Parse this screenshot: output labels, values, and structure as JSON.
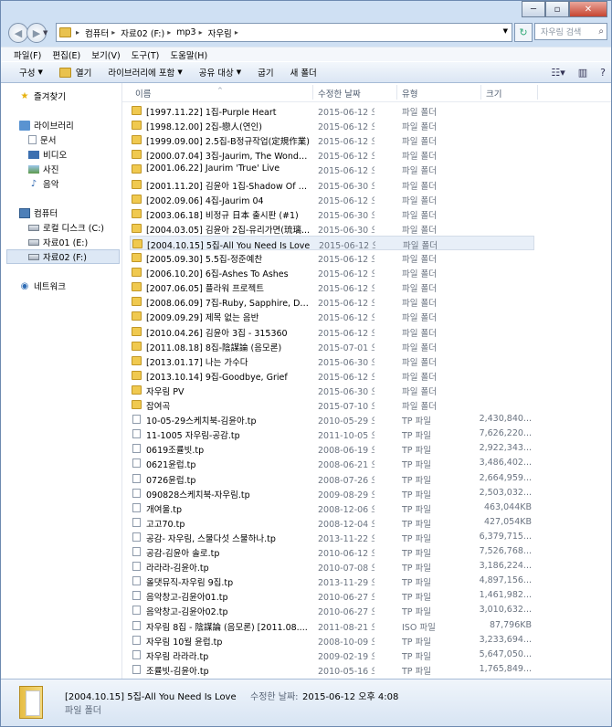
{
  "window": {
    "address": [
      "컴퓨터",
      "자료02 (F:)",
      "mp3",
      "자우림"
    ],
    "search_placeholder": "자우림 검색"
  },
  "menu": [
    "파일(F)",
    "편집(E)",
    "보기(V)",
    "도구(T)",
    "도움말(H)"
  ],
  "toolbar": {
    "organize": "구성",
    "open": "열기",
    "include_library": "라이브러리에 포함",
    "share": "공유 대상",
    "burn": "굽기",
    "new_folder": "새 폴더"
  },
  "nav": {
    "favorites": "즐겨찾기",
    "libraries": "라이브러리",
    "documents": "문서",
    "videos": "비디오",
    "pictures": "사진",
    "music": "음악",
    "computer": "컴퓨터",
    "local_disk": "로컬 디스크 (C:)",
    "data01": "자료01 (E:)",
    "data02": "자료02 (F:)",
    "network": "네트워크"
  },
  "columns": {
    "name": "이름",
    "date": "수정한 날짜",
    "type": "유형",
    "size": "크기"
  },
  "rows": [
    {
      "name": "[1997.11.22] 1집-Purple Heart",
      "date": "2015-06-12 오후...",
      "type": "파일 폴더",
      "size": "",
      "kind": "folder"
    },
    {
      "name": "[1998.12.00] 2집-戀人(연인)",
      "date": "2015-06-12 오후...",
      "type": "파일 폴더",
      "size": "",
      "kind": "folder"
    },
    {
      "name": "[1999.09.00] 2.5집-B정규작업(定規作業)",
      "date": "2015-06-12 오후...",
      "type": "파일 폴더",
      "size": "",
      "kind": "folder"
    },
    {
      "name": "[2000.07.04] 3집-Jaurim, The Wonder L...",
      "date": "2015-06-12 오후...",
      "type": "파일 폴더",
      "size": "",
      "kind": "folder"
    },
    {
      "name": "[2001.06.22] Jaurim 'True' Live",
      "date": "2015-06-12 오후...",
      "type": "파일 폴더",
      "size": "",
      "kind": "folder"
    },
    {
      "name": "[2001.11.20] 김윤아 1집-Shadow Of Yo...",
      "date": "2015-06-30 오후...",
      "type": "파일 폴더",
      "size": "",
      "kind": "folder"
    },
    {
      "name": "[2002.09.06] 4집-Jaurim 04",
      "date": "2015-06-12 오후...",
      "type": "파일 폴더",
      "size": "",
      "kind": "folder"
    },
    {
      "name": "[2003.06.18] 비정규 日本 출시판 (#1)",
      "date": "2015-06-30 오후...",
      "type": "파일 폴더",
      "size": "",
      "kind": "folder"
    },
    {
      "name": "[2004.03.05] 김윤아 2집-유리가면(琉璃...",
      "date": "2015-06-30 오후...",
      "type": "파일 폴더",
      "size": "",
      "kind": "folder"
    },
    {
      "name": "[2004.10.15] 5집-All You Need Is Love",
      "date": "2015-06-12 오후...",
      "type": "파일 폴더",
      "size": "",
      "kind": "folder",
      "selected": true
    },
    {
      "name": "[2005.09.30] 5.5집-정준예찬",
      "date": "2015-06-12 오후...",
      "type": "파일 폴더",
      "size": "",
      "kind": "folder"
    },
    {
      "name": "[2006.10.20] 6집-Ashes To Ashes",
      "date": "2015-06-12 오후...",
      "type": "파일 폴더",
      "size": "",
      "kind": "folder"
    },
    {
      "name": "[2007.06.05] 플라워 프로젝트",
      "date": "2015-06-12 오후...",
      "type": "파일 폴더",
      "size": "",
      "kind": "folder"
    },
    {
      "name": "[2008.06.09] 7집-Ruby, Sapphire, Diam...",
      "date": "2015-06-12 오후...",
      "type": "파일 폴더",
      "size": "",
      "kind": "folder"
    },
    {
      "name": "[2009.09.29] 제목 없는 음반",
      "date": "2015-06-12 오후...",
      "type": "파일 폴더",
      "size": "",
      "kind": "folder"
    },
    {
      "name": "[2010.04.26] 김윤아 3집 - 315360",
      "date": "2015-06-12 오후...",
      "type": "파일 폴더",
      "size": "",
      "kind": "folder"
    },
    {
      "name": "[2011.08.18] 8집-陰謀論 (음모론)",
      "date": "2015-07-01 오전...",
      "type": "파일 폴더",
      "size": "",
      "kind": "folder"
    },
    {
      "name": "[2013.01.17] 나는 가수다",
      "date": "2015-06-30 오후...",
      "type": "파일 폴더",
      "size": "",
      "kind": "folder"
    },
    {
      "name": "[2013.10.14] 9집-Goodbye, Grief",
      "date": "2015-06-12 오후...",
      "type": "파일 폴더",
      "size": "",
      "kind": "folder"
    },
    {
      "name": "자우림 PV",
      "date": "2015-06-30 오후...",
      "type": "파일 폴더",
      "size": "",
      "kind": "folder"
    },
    {
      "name": "잡여곡",
      "date": "2015-07-10 오후...",
      "type": "파일 폴더",
      "size": "",
      "kind": "folder"
    },
    {
      "name": "10-05-29스케치북-김윤아.tp",
      "date": "2010-05-29 오전...",
      "type": "TP 파일",
      "size": "2,430,840...",
      "kind": "file"
    },
    {
      "name": "11-1005 자우림-공감.tp",
      "date": "2011-10-05 오전...",
      "type": "TP 파일",
      "size": "7,626,220...",
      "kind": "file"
    },
    {
      "name": "0619조률빗.tp",
      "date": "2008-06-19 오전...",
      "type": "TP 파일",
      "size": "2,922,343...",
      "kind": "file"
    },
    {
      "name": "0621윤럽.tp",
      "date": "2008-06-21 오전...",
      "type": "TP 파일",
      "size": "3,486,402...",
      "kind": "file"
    },
    {
      "name": "0726윤럽.tp",
      "date": "2008-07-26 오전...",
      "type": "TP 파일",
      "size": "2,664,959...",
      "kind": "file"
    },
    {
      "name": "090828스케치북-자우림.tp",
      "date": "2009-08-29 오전...",
      "type": "TP 파일",
      "size": "2,503,032...",
      "kind": "file"
    },
    {
      "name": "개여울.tp",
      "date": "2008-12-06 오후...",
      "type": "TP 파일",
      "size": "463,044KB",
      "kind": "file"
    },
    {
      "name": "고고70.tp",
      "date": "2008-12-04 오후...",
      "type": "TP 파일",
      "size": "427,054KB",
      "kind": "file"
    },
    {
      "name": "공감- 자우림, 스물다섯 스물하나.tp",
      "date": "2013-11-22 오전...",
      "type": "TP 파일",
      "size": "6,379,715...",
      "kind": "file"
    },
    {
      "name": "공감-김윤아 솔로.tp",
      "date": "2010-06-12 오전...",
      "type": "TP 파일",
      "size": "7,526,768...",
      "kind": "file"
    },
    {
      "name": "라라라-김윤아.tp",
      "date": "2010-07-08 오전...",
      "type": "TP 파일",
      "size": "3,186,224...",
      "kind": "file"
    },
    {
      "name": "올댓뮤직-자우림 9집.tp",
      "date": "2013-11-29 오전...",
      "type": "TP 파일",
      "size": "4,897,156...",
      "kind": "file"
    },
    {
      "name": "음악창고-김윤아01.tp",
      "date": "2010-06-27 오후...",
      "type": "TP 파일",
      "size": "1,461,982...",
      "kind": "file"
    },
    {
      "name": "음악창고-김윤아02.tp",
      "date": "2010-06-27 오후...",
      "type": "TP 파일",
      "size": "3,010,632...",
      "kind": "file"
    },
    {
      "name": "자우림 8집 - 陰謀論 (음모론) [2011.08....",
      "date": "2011-08-21 오전...",
      "type": "ISO 파일",
      "size": "87,796KB",
      "kind": "file"
    },
    {
      "name": "자우림 10월 윤럽.tp",
      "date": "2008-10-09 오후...",
      "type": "TP 파일",
      "size": "3,233,694...",
      "kind": "file"
    },
    {
      "name": "자우림 라라라.tp",
      "date": "2009-02-19 오전...",
      "type": "TP 파일",
      "size": "5,647,050...",
      "kind": "file"
    },
    {
      "name": "조률빗-김윤아.tp",
      "date": "2010-05-16 오전...",
      "type": "TP 파일",
      "size": "1,765,849...",
      "kind": "file"
    }
  ],
  "details": {
    "name": "[2004.10.15] 5집-All You Need Is Love",
    "date_label": "수정한 날짜:",
    "date_value": "2015-06-12 오후 4:08",
    "type": "파일 폴더"
  }
}
